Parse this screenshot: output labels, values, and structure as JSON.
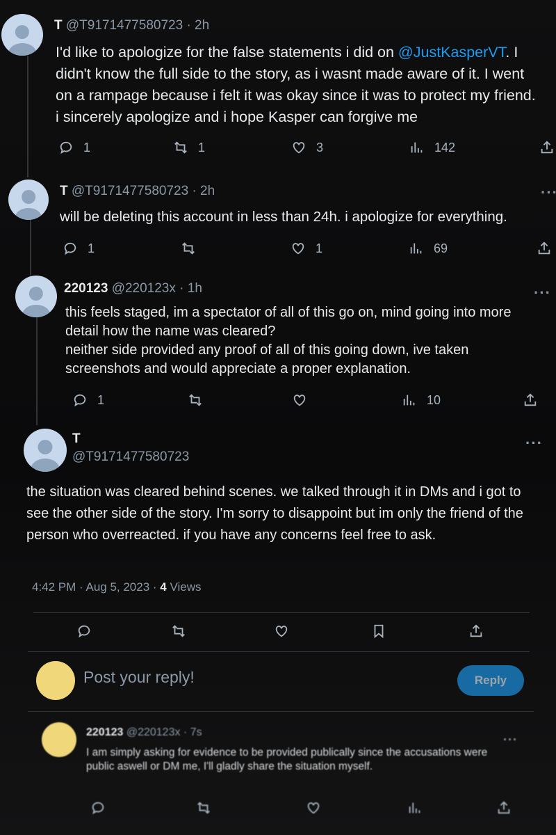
{
  "tweets": [
    {
      "name": "T",
      "handle": "@T9171477580723",
      "time": "· 2h",
      "text_before": "I'd like to apologize for the false statements i did on ",
      "mention": "@JustKasperVT",
      "text_after": ". I didn't know the full side to the story, as i wasnt made aware of it. I went on a rampage because i felt it was okay since it was to protect my friend. i sincerely apologize and i hope Kasper can forgive me",
      "replies": "1",
      "retweets": "1",
      "likes": "3",
      "views": "142"
    },
    {
      "name": "T",
      "handle": "@T9171477580723",
      "time": "· 2h",
      "text": "will be deleting this account in less than 24h. i apologize for everything.",
      "replies": "1",
      "retweets": "",
      "likes": "1",
      "views": "69"
    },
    {
      "name": "220123",
      "handle": "@220123x",
      "time": "· 1h",
      "text_line1": "this feels staged, im a spectator of all of this go on, mind going into more detail how the name was cleared?",
      "text_line2": "neither side provided any proof of all of this going down, ive taken screenshots and would appreciate a proper explanation.",
      "replies": "1",
      "retweets": "",
      "likes": "",
      "views": "10"
    }
  ],
  "main": {
    "name": "T",
    "handle": "@T9171477580723",
    "text": "the situation was cleared behind scenes. we talked through it in DMs and i got to see the other side of the story. I'm sorry to disappoint but im only the friend of the person who overreacted. if you have any concerns feel free to ask.",
    "timestamp": "4:42 PM · Aug 5, 2023 · ",
    "views_count": "4",
    "views_label": " Views"
  },
  "composer": {
    "placeholder": "Post your reply!",
    "button": "Reply"
  },
  "last_reply": {
    "name": "220123",
    "handle": "@220123x",
    "time": "· 7s",
    "text": "I am simply asking for evidence to be provided publically since the accusations were public aswell or DM me, I'll gladly share the situation myself."
  },
  "icons": {
    "reply": "reply-icon",
    "retweet": "retweet-icon",
    "like": "heart-icon",
    "views": "views-icon",
    "share": "share-icon",
    "bookmark": "bookmark-icon",
    "more": "more-icon"
  },
  "colors": {
    "background": "#0b0b0b",
    "accent": "#1d9bf0",
    "text": "#e7e9ea",
    "secondary": "#8b98a5"
  }
}
